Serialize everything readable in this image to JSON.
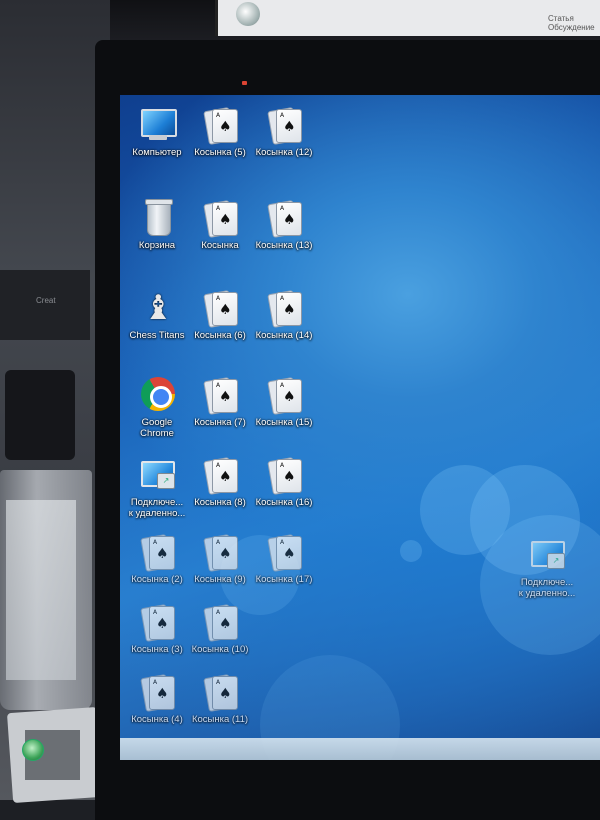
{
  "background_screen": {
    "text": "Статья  Обсуждение"
  },
  "device_label": "Creat",
  "desktop": {
    "icons": [
      {
        "key": "computer",
        "label": "Компьютер",
        "type": "computer"
      },
      {
        "key": "k5",
        "label": "Косынка (5)",
        "type": "solitaire"
      },
      {
        "key": "k12",
        "label": "Косынка (12)",
        "type": "solitaire"
      },
      {
        "key": "recycle",
        "label": "Корзина",
        "type": "recycle-bin"
      },
      {
        "key": "k",
        "label": "Косынка",
        "type": "solitaire"
      },
      {
        "key": "k13",
        "label": "Косынка (13)",
        "type": "solitaire"
      },
      {
        "key": "chess",
        "label": "Chess Titans",
        "type": "chess"
      },
      {
        "key": "k6",
        "label": "Косынка (6)",
        "type": "solitaire"
      },
      {
        "key": "k14",
        "label": "Косынка (14)",
        "type": "solitaire"
      },
      {
        "key": "chrome",
        "label": "Google\nChrome",
        "type": "chrome"
      },
      {
        "key": "k7",
        "label": "Косынка (7)",
        "type": "solitaire"
      },
      {
        "key": "k15",
        "label": "Косынка (15)",
        "type": "solitaire"
      },
      {
        "key": "rdp1",
        "label": "Подключе...\nк удаленно...",
        "type": "remote-desktop"
      },
      {
        "key": "k8",
        "label": "Косынка (8)",
        "type": "solitaire"
      },
      {
        "key": "k16",
        "label": "Косынка (16)",
        "type": "solitaire"
      },
      {
        "key": "k2",
        "label": "Косынка (2)",
        "type": "solitaire"
      },
      {
        "key": "k9",
        "label": "Косынка (9)",
        "type": "solitaire"
      },
      {
        "key": "k17",
        "label": "Косынка (17)",
        "type": "solitaire"
      },
      {
        "key": "k3",
        "label": "Косынка (3)",
        "type": "solitaire"
      },
      {
        "key": "k10",
        "label": "Косынка (10)",
        "type": "solitaire"
      },
      {
        "key": "k4",
        "label": "Косынка (4)",
        "type": "solitaire"
      },
      {
        "key": "k11",
        "label": "Косынка (11)",
        "type": "solitaire"
      },
      {
        "key": "rdp2",
        "label": "Подключе...\nк удаленно...",
        "type": "remote-desktop"
      }
    ]
  },
  "card_glyphs": {
    "spade": "♠",
    "corner": "A"
  },
  "chess_glyph": "♝",
  "rdp_badge": "↗"
}
